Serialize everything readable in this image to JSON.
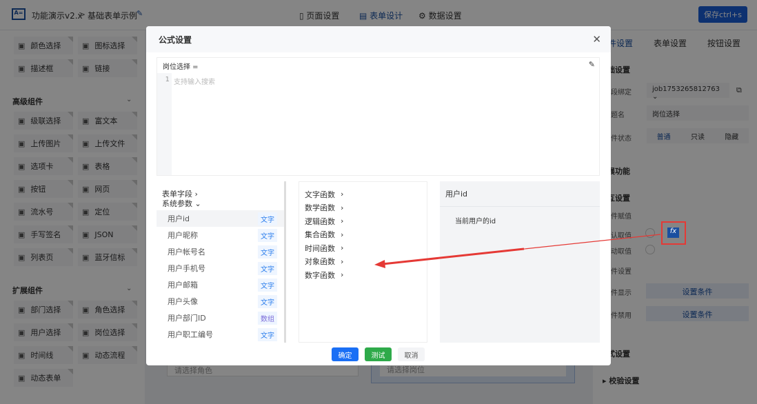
{
  "header": {
    "app": "功能演示v2.x",
    "sep": ">",
    "page": "基础表单示例",
    "tabs": [
      "页面设置",
      "表单设计",
      "数据设置"
    ],
    "save": "保存ctrl+s"
  },
  "sidebar": {
    "basic": [
      [
        "颜色选择",
        "图标选择"
      ],
      [
        "描述框",
        "链接"
      ]
    ],
    "advanced_title": "高级组件",
    "advanced": [
      [
        "级联选择",
        "富文本"
      ],
      [
        "上传图片",
        "上传文件"
      ],
      [
        "选项卡",
        "表格"
      ],
      [
        "按钮",
        "网页"
      ],
      [
        "流水号",
        "定位"
      ],
      [
        "手写签名",
        "JSON"
      ],
      [
        "列表页",
        "蓝牙信标"
      ]
    ],
    "ext_title": "扩展组件",
    "ext": [
      [
        "部门选择",
        "角色选择"
      ],
      [
        "用户选择",
        "岗位选择"
      ],
      [
        "时间线",
        "动态流程"
      ],
      [
        "动态表单"
      ]
    ]
  },
  "canvas": {
    "role_placeholder": "请选择角色",
    "post_placeholder": "请选择岗位"
  },
  "right": {
    "tabs": [
      "组件设置",
      "表单设置",
      "按钮设置"
    ],
    "basic": "基础设置",
    "bind_label": "字段绑定",
    "bind_value": "job1753265812763",
    "name_label": "标题名",
    "name_value": "岗位选择",
    "state_label": "组件状态",
    "states": [
      "普通",
      "只读",
      "隐藏"
    ],
    "ext": "扩展功能",
    "interact": "交互设置",
    "assign": "组件赋值",
    "get1": "默认取值",
    "get2": "联动取值",
    "cond": "条件设置",
    "show": "条件显示",
    "disable": "条件禁用",
    "set_cond": "设置条件",
    "style": "样式设置",
    "validate": "校验设置"
  },
  "modal": {
    "title": "公式设置",
    "formula_label": "岗位选择 =",
    "line": "1",
    "placeholder": "支持输入搜索",
    "groups": [
      "表单字段",
      "系统参数"
    ],
    "fields": [
      {
        "name": "用户id",
        "type": "文字"
      },
      {
        "name": "用户昵称",
        "type": "文字"
      },
      {
        "name": "用户帐号名",
        "type": "文字"
      },
      {
        "name": "用户手机号",
        "type": "文字"
      },
      {
        "name": "用户邮箱",
        "type": "文字"
      },
      {
        "name": "用户头像",
        "type": "文字"
      },
      {
        "name": "用户部门ID",
        "type": "数组"
      },
      {
        "name": "用户职工编号",
        "type": "文字"
      }
    ],
    "functions": [
      "文字函数",
      "数学函数",
      "逻辑函数",
      "集合函数",
      "时间函数",
      "对象函数",
      "数字函数"
    ],
    "detail_title": "用户id",
    "detail_desc": "当前用户的id",
    "ok": "确定",
    "test": "测试",
    "cancel": "取消"
  },
  "colors": {
    "primary": "#1a5fd6",
    "annotation": "#e53935",
    "test": "#2eaa4a"
  }
}
